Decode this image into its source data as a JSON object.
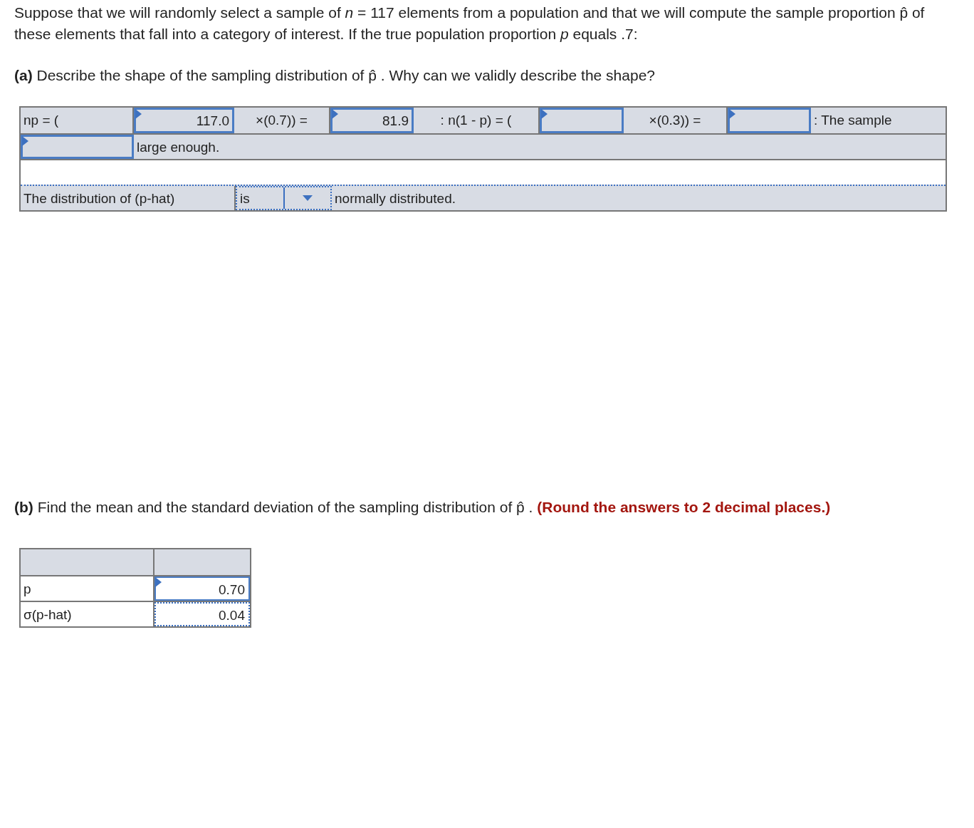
{
  "intro": "Suppose that we will randomly select a sample of *n* = 117 elements from a population and that we will compute the sample proportion p̂ of these elements that fall into a category of interest. If the true population proportion *p* equals .7:",
  "part_a": {
    "label": "(a)",
    "text": "Describe the shape of the sampling distribution of p̂ . Why can we validly describe the shape?",
    "rows": [
      [
        {
          "kind": "text",
          "text": "np = ("
        },
        {
          "kind": "input",
          "value": "117.0"
        },
        {
          "kind": "op",
          "text": "×(0.7)) ="
        },
        {
          "kind": "input",
          "value": "81.9"
        },
        {
          "kind": "op",
          "text": ": n(1 - p) = ("
        },
        {
          "kind": "input"
        },
        {
          "kind": "op",
          "text": "×(0.3)) ="
        },
        {
          "kind": "input"
        },
        {
          "kind": "text",
          "text": ": The sample"
        }
      ],
      [
        {
          "kind": "input"
        },
        {
          "kind": "text",
          "text": "large enough."
        }
      ]
    ],
    "statement": {
      "label": "The distribution of (p-hat)",
      "choice": "is",
      "text": "normally distributed."
    }
  },
  "part_b": {
    "label": "(b)",
    "text": "Find the mean and the standard deviation of the sampling distribution of p̂ .",
    "note": "(Round the answers to 2 decimal places.)",
    "rows": [
      {
        "label": "p",
        "value": "0.70",
        "focused": true
      },
      {
        "label": "σ(p-hat)",
        "value": "0.04",
        "focused": false
      }
    ]
  }
}
